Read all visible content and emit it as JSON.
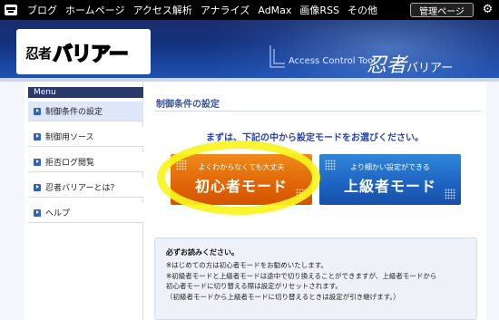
{
  "topbar": {
    "nav": [
      "ブログ",
      "ホームページ",
      "アクセス解析",
      "アナライズ",
      "AdMax",
      "画像RSS",
      "その他"
    ],
    "admin_label": "管理ページ",
    "gear_icon": "gear-icon"
  },
  "header": {
    "brand_small": "忍者",
    "brand_big": "バリアー",
    "product_label": "Access Control Tool",
    "ninja_big": "忍者",
    "ninja_small": "バリアー"
  },
  "sidebar": {
    "menu_label": "Menu",
    "items": [
      {
        "label": "制御条件の設定",
        "active": true
      },
      {
        "label": "制御用ソース",
        "active": false
      },
      {
        "label": "拒否ログ閲覧",
        "active": false
      },
      {
        "label": "忍者バリアーとは？",
        "active": false
      },
      {
        "label": "ヘルプ",
        "active": false
      }
    ]
  },
  "main": {
    "title": "制御条件の設定",
    "instruction": "まずは、下記の中から設定モードをお選びください。",
    "beginner": {
      "sub": "よくわからなくても大丈夫",
      "label": "初心者モード"
    },
    "advanced": {
      "sub": "より細かい設定ができる",
      "label": "上級者モード"
    }
  },
  "notice": {
    "title": "必ずお読みください。",
    "lines": [
      "※はじめての方は初心者モードをお勧めいたします。",
      "※初級者モードと上級者モードは途中で切り換えることができますが、上級者モードから",
      "初心者モードに切り替える際は設定がリセットされます。",
      "（初級者モードから上級者モードに切り替えるときは設定が引き継げます。）"
    ]
  },
  "colors": {
    "accent_orange": "#e06505",
    "accent_blue": "#1e63c1",
    "highlight_yellow": "#f8f41e",
    "header_navy": "#14317f"
  }
}
